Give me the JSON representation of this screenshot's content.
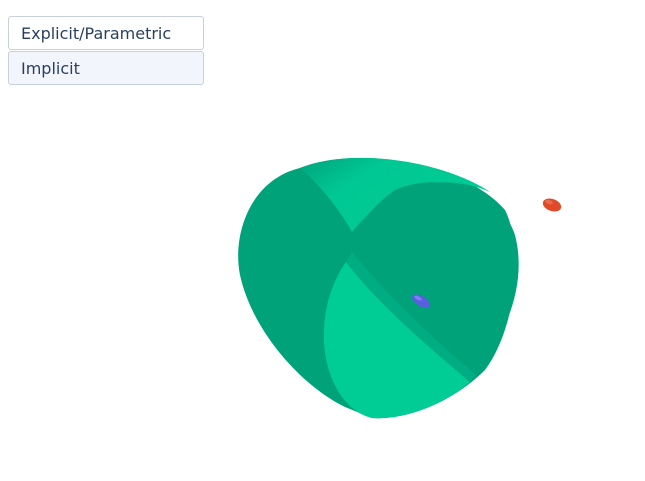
{
  "update_menu": {
    "buttons": [
      {
        "label": "Explicit/Parametric",
        "active": false
      },
      {
        "label": "Implicit",
        "active": true
      }
    ]
  },
  "scene": {
    "surface_color": "#00a27a",
    "surface_highlight_color": "#00cc95",
    "marker_blue_color": "#5a5fe0",
    "marker_red_color": "#e04a2a"
  }
}
